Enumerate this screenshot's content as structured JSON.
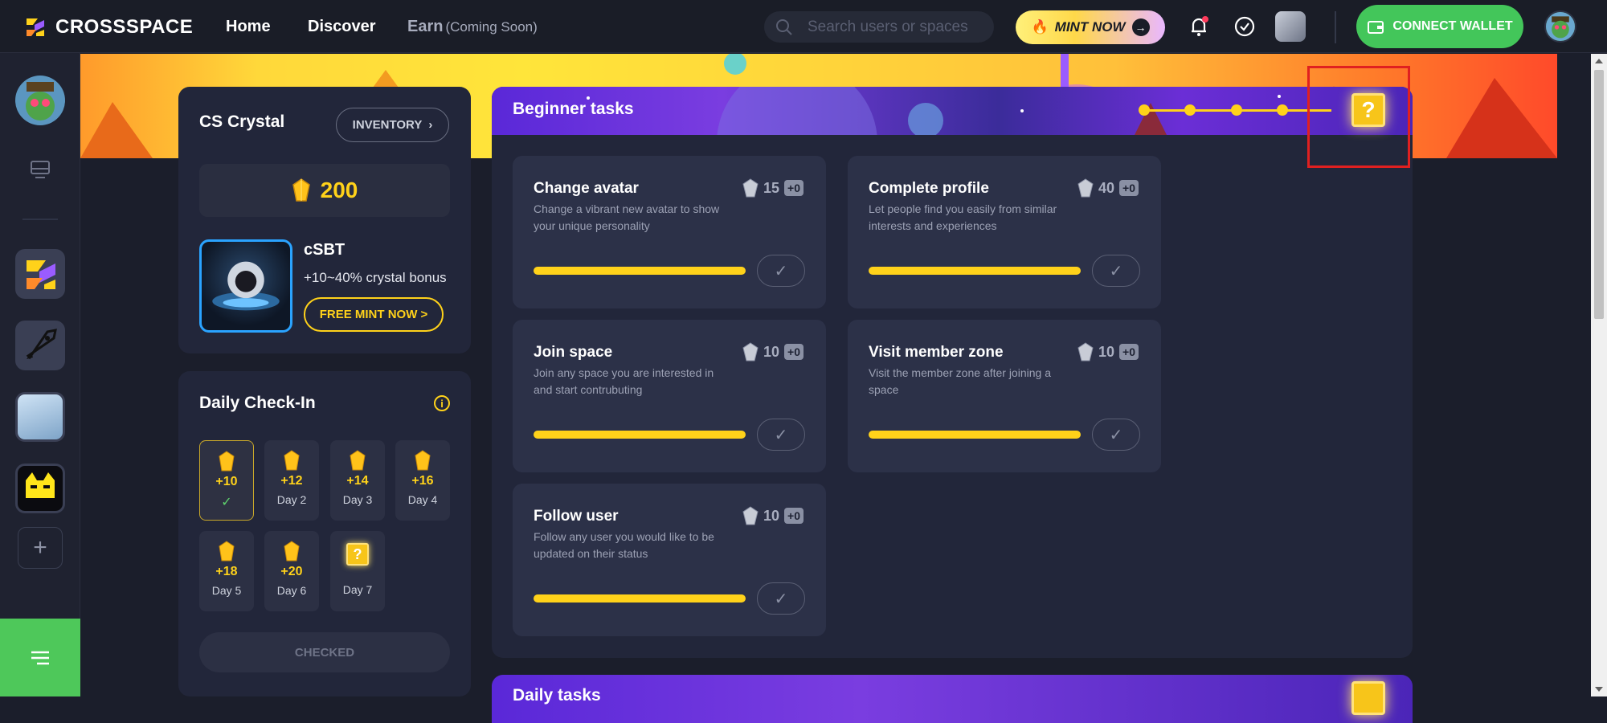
{
  "header": {
    "brand": "CROSSSPACE",
    "nav": {
      "home": "Home",
      "discover": "Discover",
      "earn": "Earn",
      "earn_note": "(Coming Soon)"
    },
    "search_placeholder": "Search users or spaces",
    "mint_label": "MINT NOW",
    "connect_label": "CONNECT WALLET"
  },
  "crystal": {
    "title": "CS Crystal",
    "inventory_label": "INVENTORY",
    "amount": "200",
    "sbt_title": "cSBT",
    "sbt_bonus": "+10~40% crystal bonus",
    "sbt_button": "FREE MINT NOW >"
  },
  "checkin": {
    "title": "Daily Check-In",
    "info": "i",
    "days": [
      {
        "amount": "+10",
        "label": "",
        "checked": true
      },
      {
        "amount": "+12",
        "label": "Day 2"
      },
      {
        "amount": "+14",
        "label": "Day 3"
      },
      {
        "amount": "+16",
        "label": "Day 4"
      },
      {
        "amount": "+18",
        "label": "Day 5"
      },
      {
        "amount": "+20",
        "label": "Day 6"
      },
      {
        "amount": "",
        "label": "Day 7"
      }
    ],
    "check_mark": "✓",
    "checked_label": "CHECKED"
  },
  "beginner": {
    "title": "Beginner tasks",
    "mystery": "?",
    "tasks": [
      {
        "title": "Change avatar",
        "desc": "Change a vibrant new avatar to show your unique personality",
        "reward": "15",
        "bonus": "+0"
      },
      {
        "title": "Complete profile",
        "desc": "Let people find you easily from similar interests and experiences",
        "reward": "40",
        "bonus": "+0"
      },
      {
        "title": "Join space",
        "desc": "Join any space you are interested in and start contrubuting",
        "reward": "10",
        "bonus": "+0"
      },
      {
        "title": "Visit member zone",
        "desc": "Visit the member zone after joining a space",
        "reward": "10",
        "bonus": "+0"
      },
      {
        "title": "Follow user",
        "desc": "Follow any user you would like to be updated on their status",
        "reward": "10",
        "bonus": "+0"
      }
    ]
  },
  "daily": {
    "title": "Daily tasks"
  },
  "sidebar": {
    "add": "+"
  },
  "colors": {
    "accent": "#ffd21a",
    "green": "#43c65a",
    "panel": "#22263a",
    "highlight": "#e02020"
  }
}
